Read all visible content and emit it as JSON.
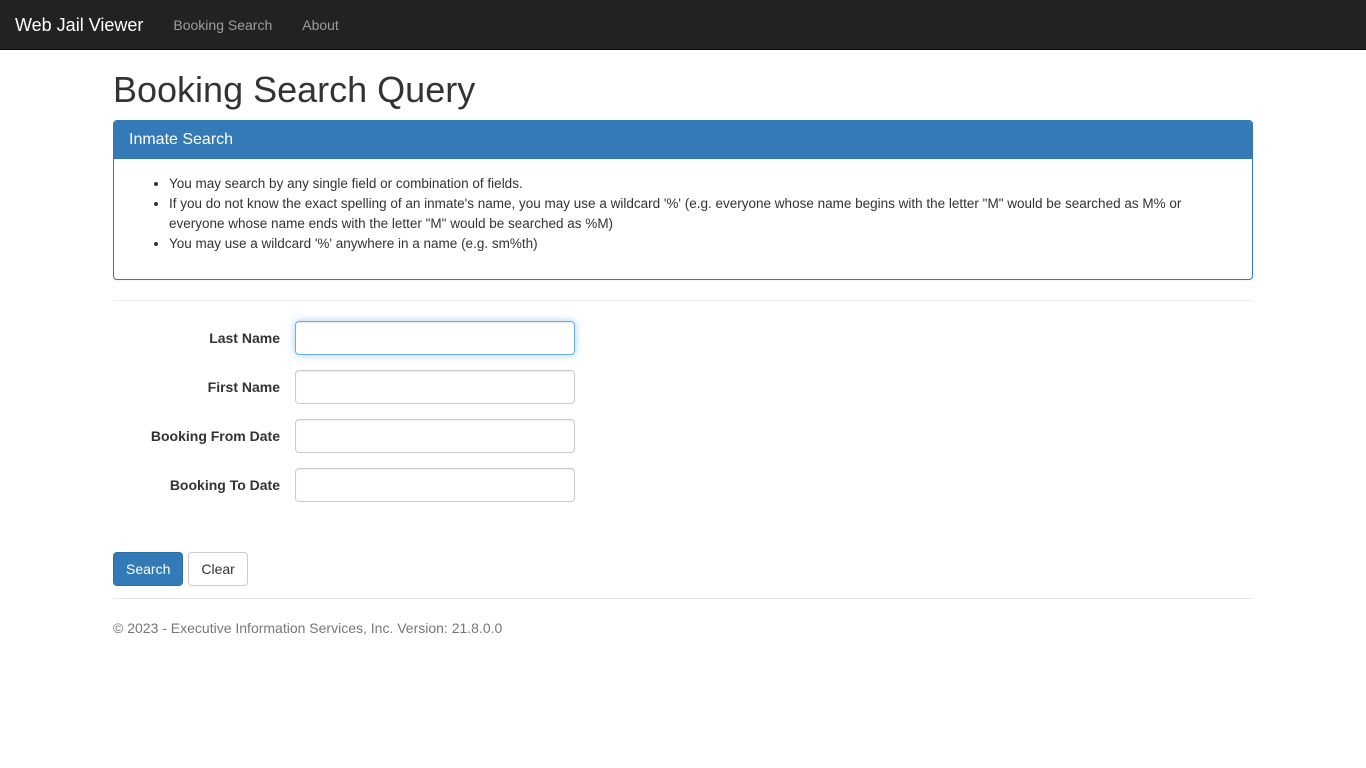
{
  "navbar": {
    "brand": "Web Jail Viewer",
    "links": [
      {
        "label": "Booking Search"
      },
      {
        "label": "About"
      }
    ],
    "background_color": "#222222",
    "link_color": "#9d9d9d"
  },
  "page": {
    "title": "Booking Search Query"
  },
  "panel": {
    "heading": "Inmate Search",
    "accent_color": "#337ab7",
    "bullets": [
      "You may search by any single field or combination of fields.",
      "If you do not know the exact spelling of an inmate's name, you may use a wildcard '%' (e.g. everyone whose name begins with the letter \"M\" would be searched as M% or everyone whose name ends with the letter \"M\" would be searched as %M)",
      "You may use a wildcard '%' anywhere in a name (e.g. sm%th)"
    ]
  },
  "form": {
    "fields": [
      {
        "label": "Last Name",
        "value": "",
        "placeholder": "",
        "focused": true
      },
      {
        "label": "First Name",
        "value": "",
        "placeholder": "",
        "focused": false
      },
      {
        "label": "Booking From Date",
        "value": "",
        "placeholder": "",
        "focused": false
      },
      {
        "label": "Booking To Date",
        "value": "",
        "placeholder": "",
        "focused": false
      }
    ],
    "buttons": {
      "search_label": "Search",
      "clear_label": "Clear"
    }
  },
  "footer": {
    "text": "© 2023 - Executive Information Services, Inc. Version: 21.8.0.0"
  }
}
